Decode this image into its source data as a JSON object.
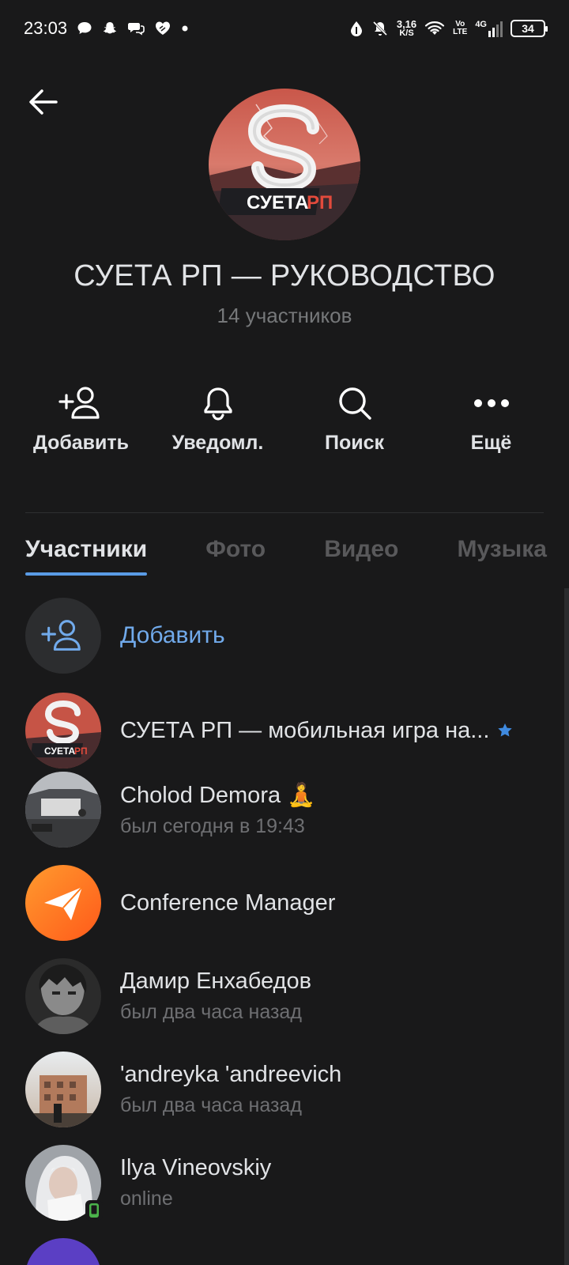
{
  "status_bar": {
    "time": "23:03",
    "net_speed_value": "3,16",
    "net_speed_unit": "K/S",
    "volte_top": "Vo",
    "volte_bottom": "LTE",
    "network": "4G",
    "battery": "34"
  },
  "header": {
    "title": "СУЕТА РП — РУКОВОДСТВО",
    "subtitle": "14 участников",
    "avatar_text": "СУЕТА",
    "avatar_text_accent": "РП"
  },
  "actions": [
    {
      "label": "Добавить",
      "icon": "add-user-icon"
    },
    {
      "label": "Уведомл.",
      "icon": "bell-icon"
    },
    {
      "label": "Поиск",
      "icon": "search-icon"
    },
    {
      "label": "Ещё",
      "icon": "more-icon"
    }
  ],
  "tabs": [
    {
      "label": "Участники",
      "active": true
    },
    {
      "label": "Фото",
      "active": false
    },
    {
      "label": "Видео",
      "active": false
    },
    {
      "label": "Музыка",
      "active": false
    }
  ],
  "add_member": {
    "label": "Добавить"
  },
  "members": [
    {
      "name": "СУЕТА РП — мобильная игра на...",
      "status": "",
      "verified": true
    },
    {
      "name": "Cholod Demora 🧘",
      "status": "был сегодня в 19:43"
    },
    {
      "name": "Conference Manager",
      "status": ""
    },
    {
      "name": "Дамир Енхабедов",
      "status": "был два часа назад"
    },
    {
      "name": "'andreyka 'andreevich",
      "status": "был два часа назад"
    },
    {
      "name": "Ilya Vineovskiy",
      "status": "online",
      "mobile": true
    }
  ],
  "colors": {
    "background": "#19191a",
    "accent": "#71aaeb",
    "tab_indicator": "#5a9be6",
    "online_green": "#4bb34b",
    "conference_orange": "#ff7a1a"
  }
}
